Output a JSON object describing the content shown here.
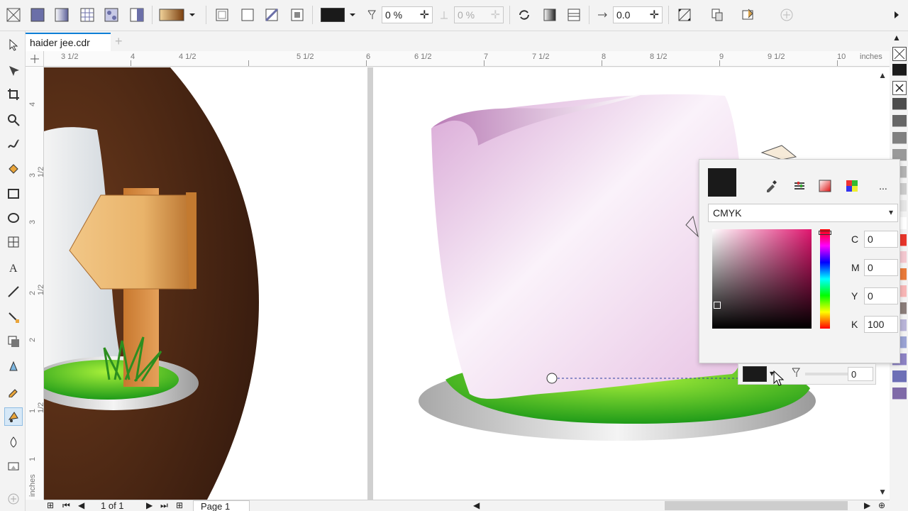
{
  "property_bar": {
    "fill_value": "0 %",
    "fill_value_disabled": "0 %",
    "offset_value": "0.0",
    "color": "#1a1a1a"
  },
  "document": {
    "tab_title": "haider jee.cdr"
  },
  "ruler": {
    "unit": "inches",
    "h_ticks": [
      "3 1/2",
      "4",
      "4 1/2",
      "5 1/2",
      "6",
      "6 1/2",
      "7",
      "7 1/2",
      "8",
      "8 1/2",
      "9",
      "9 1/2",
      "10"
    ],
    "v_ticks": [
      "4",
      "3 1/2",
      "3",
      "2 1/2",
      "2",
      "1 1/2",
      "1"
    ],
    "v_unit": "inches"
  },
  "status": {
    "page_count": "1 of 1",
    "page_label": "Page 1"
  },
  "color_docker": {
    "model": "CMYK",
    "c": "0",
    "m": "0",
    "y": "0",
    "k": "100",
    "labels": {
      "c": "C",
      "m": "M",
      "y": "Y",
      "k": "K"
    },
    "current_color": "#1a1a1a",
    "more": "..."
  },
  "fill_bar": {
    "transparency": "0"
  },
  "palette": {
    "colors": [
      "#1a1a1a",
      "#333333",
      "#4d4d4d",
      "#666666",
      "#808080",
      "#999999",
      "#b3b3b3",
      "#cccccc",
      "#e6e6e6",
      "#ffffff",
      "#e8352a",
      "#f3c8d0",
      "#e97a3a",
      "#f7b6b6",
      "#8b7d7a",
      "#b9b4d8",
      "#9aa3d4",
      "#8d83c4",
      "#6d6fb6",
      "#7f6aa8"
    ]
  }
}
